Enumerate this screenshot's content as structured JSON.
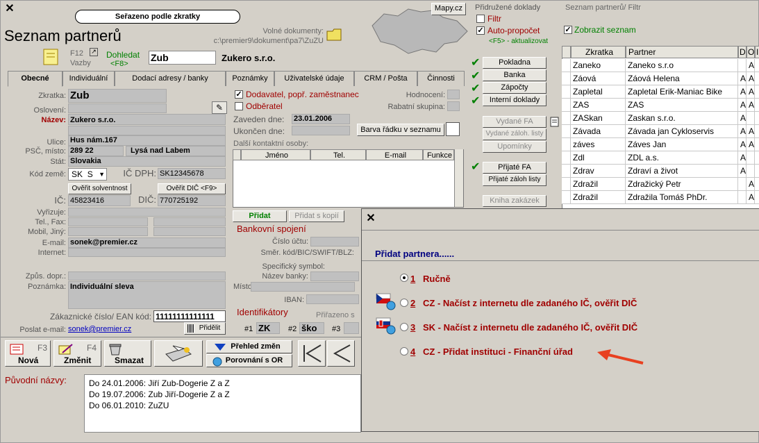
{
  "header": {
    "sort_bubble": "Seřazeno podle zkratky",
    "title": "Seznam partnerů",
    "volne_label": "Volné dokumenty:",
    "volne_path": "c:\\premier9\\dokument\\pa7\\ZuZU",
    "mapy": "Mapy.cz",
    "f12": "F12",
    "vazby": "Vazby",
    "dohledat": "Dohledat",
    "f8": "<F8>",
    "search_value": "Zub",
    "partner_name": "Zukero s.r.o."
  },
  "prid": {
    "title": "Přidružené doklady",
    "filtr": "Filtr",
    "autoprep": "Auto-propočet",
    "f5": "<F5> - aktualizovat",
    "buttons": [
      "Pokladna",
      "Banka",
      "Zápočty",
      "Interní doklady"
    ],
    "disabled_buttons": [
      "Vydané FA",
      "Vydané záloh. listy",
      "Upomínky"
    ],
    "buttons2": [
      "Přijaté FA",
      "Přijaté záloh listy"
    ],
    "kniha": "Kniha zakázek"
  },
  "seznam": {
    "title": "Seznam partnerů/ Filtr",
    "zobrazit": "Zobrazit seznam",
    "headers": [
      "Zkratka",
      "Partner",
      "D",
      "O",
      "I"
    ],
    "rows": [
      {
        "z": "Zaneko",
        "p": "Zaneko s.r.o",
        "d": "",
        "o": "A"
      },
      {
        "z": "Záová",
        "p": "Záová Helena",
        "d": "A",
        "o": "A"
      },
      {
        "z": "Zapletal",
        "p": "Zapletal Erik-Maniac Bike",
        "d": "A",
        "o": "A"
      },
      {
        "z": "ZAS",
        "p": "ZAS",
        "d": "A",
        "o": "A"
      },
      {
        "z": "ZASkan",
        "p": "Zaskan s.r.o.",
        "d": "A",
        "o": ""
      },
      {
        "z": "Závada",
        "p": "Závada jan Cykloservis",
        "d": "A",
        "o": "A"
      },
      {
        "z": "záves",
        "p": "Záves Jan",
        "d": "A",
        "o": "A"
      },
      {
        "z": "Zdl",
        "p": "ZDL a.s.",
        "d": "A",
        "o": ""
      },
      {
        "z": "Zdrav",
        "p": "Zdraví a život",
        "d": "A",
        "o": ""
      },
      {
        "z": "Zdražil",
        "p": "Zdražický Petr",
        "d": "",
        "o": "A"
      },
      {
        "z": "Zdražil",
        "p": "Zdražila Tomáš PhDr.",
        "d": "",
        "o": "A"
      }
    ]
  },
  "tabs": [
    "Obecné",
    "Individuální",
    "Dodací adresy / banky",
    "Poznámky",
    "Uživatelské údaje",
    "CRM / Pošta",
    "Činnosti"
  ],
  "form": {
    "zkratka_l": "Zkratka:",
    "zkratka": "Zub",
    "osloveni_l": "Oslovení:",
    "nazev_l": "Název:",
    "nazev": "Zukero s.r.o.",
    "ulice_l": "Ulice:",
    "ulice": "Hus nám.167",
    "psc_l": "PSČ, místo:",
    "psc": "289 22",
    "misto": "Lysá nad Labem",
    "stat_l": "Stát:",
    "stat": "Slovakia",
    "kod_l": "Kód země:",
    "kod": "SK",
    "kod2": "S",
    "icdph_l": "IČ DPH:",
    "icdph": "SK12345678",
    "overit_solv": "Ověřit solventnost",
    "overit_dic": "Ověřit DIČ <F9>",
    "ic_l": "IČ:",
    "ic": "45823416",
    "dic_l": "DIČ:",
    "dic": "770725192",
    "vyrizuje_l": "Vyřizuje:",
    "telfax_l": "Tel., Fax:",
    "mobil_l": "Mobil, Jiný:",
    "email_l": "E-mail:",
    "email": "sonek@premier.cz",
    "internet_l": "Internet:",
    "zpusob_l": "Způs. dopr.:",
    "poznamka_l": "Poznámka:",
    "poznamka": "Individuální sleva",
    "ean_l": "Zákaznické číslo/ EAN kód:",
    "ean": "11111111111111",
    "poslat_l": "Poslat e-mail:",
    "poslat": "sonek@premier.cz",
    "pridelit": "Přidělit"
  },
  "mid": {
    "dodavatel": "Dodavatel, popř. zaměstnanec",
    "odberatel": "Odběratel",
    "hodnoceni": "Hodnocení:",
    "rabat": "Rabatní skupina:",
    "zaveden_l": "Zaveden dne:",
    "zaveden": "23.01.2006",
    "ukoncen_l": "Ukončen dne:",
    "barva": "Barva řádku v seznamu",
    "kontakt_l": "Další kontaktní osoby:",
    "kontakt_cols": [
      "Jméno",
      "Tel.",
      "E-mail",
      "Funkce"
    ],
    "pridat": "Přidat",
    "pridat_kopii": "Přidat s kopií",
    "bank_title": "Bankovní spojení",
    "cislo_uctu": "Číslo účtu:",
    "smer": "Směr. kód/BIC/SWIFT/BLZ:",
    "spec": "Specifický symbol:",
    "nazev_banky": "Název banky:",
    "misto": "Místo:",
    "iban": "IBAN:",
    "ident_title": "Identifikátory",
    "prirazeno": "Přiřazeno s",
    "id1": "#1",
    "id1v": "ZK",
    "id2": "#2",
    "id2v": "ško",
    "id3": "#3"
  },
  "toolbar": {
    "nova_key": "F3",
    "nova": "Nová",
    "zmenit_key": "F4",
    "zmenit": "Změnit",
    "smazat": "Smazat",
    "prehled": "Přehled změn",
    "porovnani": "Porovnání s OR"
  },
  "puvodni": {
    "label": "Původní názvy:",
    "lines": [
      "Do 24.01.2006: Jiří Zub-Dogerie Z a Z",
      "Do 19.07.2006: Zub Jiří-Dogerie Z a Z",
      "Do 06.01.2010: ZuZU"
    ]
  },
  "dialog": {
    "title": "Přidat partnera......",
    "options": [
      {
        "num": "1",
        "text": "Ručně"
      },
      {
        "num": "2",
        "text": "CZ - Načíst z internetu dle zadaného IČ, ověřit DIČ"
      },
      {
        "num": "3",
        "text": "SK - Načíst z internetu dle zadaného IČ, ověřit DIČ"
      },
      {
        "num": "4",
        "text": "CZ - Přidat instituci - Finanční úřad"
      }
    ],
    "selected": 1
  },
  "colors": {
    "accent_red": "#a00000",
    "green": "#008000",
    "dialog_title": "#000080",
    "arrow": "#e84020"
  }
}
